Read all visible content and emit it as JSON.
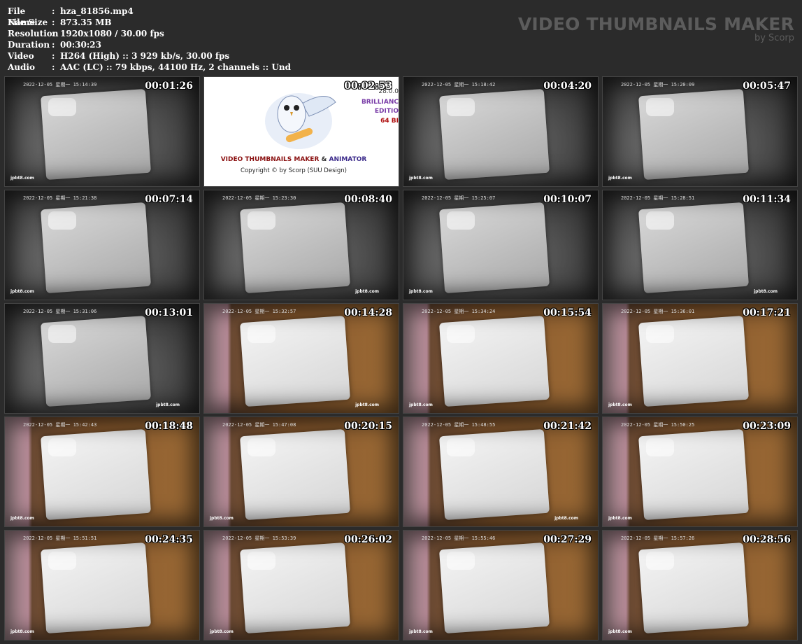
{
  "meta": [
    {
      "key": "File Name",
      "value": "hza_81856.mp4"
    },
    {
      "key": "File Size",
      "value": "873.35 MB"
    },
    {
      "key": "Resolution",
      "value": "1920x1080 / 30.00 fps"
    },
    {
      "key": "Duration",
      "value": "00:30:23"
    },
    {
      "key": "Video",
      "value": "H264 (High) :: 3 929 kb/s, 30.00 fps"
    },
    {
      "key": "Audio",
      "value": "AAC (LC) :: 79 kbps, 44100 Hz, 2 channels :: Und"
    }
  ],
  "separator": ":",
  "brand": {
    "title": "VIDEO THUMBNAILS MAKER",
    "subtitle": "by Scorp"
  },
  "splash": {
    "title_a": "VIDEO THUMBNAILS MAKER",
    "title_amp": " & ",
    "title_b": "ANIMATOR",
    "copyright": "Copyright © by Scorp (SUU Design)",
    "edition_line1": "BRILLIANC",
    "edition_line2": "EDITIO",
    "version": "28.0.0",
    "bits": "64 BI"
  },
  "thumbnails": [
    {
      "time": "00:01:26",
      "stamp": "2022-12-05 星期一 15:14:39",
      "style": "gray",
      "wm": "jpbt8.com",
      "wm_pos": "left"
    },
    {
      "time": "00:02:53",
      "style": "splash"
    },
    {
      "time": "00:04:20",
      "stamp": "2022-12-05 星期一 15:18:42",
      "style": "gray",
      "wm": "jpbt8.com",
      "wm_pos": "left"
    },
    {
      "time": "00:05:47",
      "stamp": "2022-12-05 星期一 15:20:09",
      "style": "gray",
      "wm": "jpbt8.com",
      "wm_pos": "left"
    },
    {
      "time": "00:07:14",
      "stamp": "2022-12-05 星期一 15:21:38",
      "style": "gray",
      "wm": "jpbt8.com",
      "wm_pos": "left"
    },
    {
      "time": "00:08:40",
      "stamp": "2022-12-05 星期一 15:23:30",
      "style": "gray",
      "wm": "jpbt8.com",
      "wm_pos": "right"
    },
    {
      "time": "00:10:07",
      "stamp": "2022-12-05 星期一 15:25:07",
      "style": "gray",
      "wm": "jpbt8.com",
      "wm_pos": "left"
    },
    {
      "time": "00:11:34",
      "stamp": "2022-12-05 星期一 15:28:51",
      "style": "gray",
      "wm": "jpbt8.com",
      "wm_pos": "right"
    },
    {
      "time": "00:13:01",
      "stamp": "2022-12-05 星期一 15:31:06",
      "style": "gray",
      "wm": "jpbt8.com",
      "wm_pos": "right"
    },
    {
      "time": "00:14:28",
      "stamp": "2022-12-05 星期一 15:32:57",
      "style": "color",
      "wm": "jpbt8.com",
      "wm_pos": "right"
    },
    {
      "time": "00:15:54",
      "stamp": "2022-12-05 星期一 15:34:24",
      "style": "color",
      "wm": "jpbt8.com",
      "wm_pos": "left"
    },
    {
      "time": "00:17:21",
      "stamp": "2022-12-05 星期一 15:36:01",
      "style": "color",
      "wm": "jpbt8.com",
      "wm_pos": "left"
    },
    {
      "time": "00:18:48",
      "stamp": "2022-12-05 星期一 15:42:43",
      "style": "color",
      "wm": "jpbt8.com",
      "wm_pos": "left"
    },
    {
      "time": "00:20:15",
      "stamp": "2022-12-05 星期一 15:47:08",
      "style": "color",
      "wm": "jpbt8.com",
      "wm_pos": "left"
    },
    {
      "time": "00:21:42",
      "stamp": "2022-12-05 星期一 15:48:55",
      "style": "color",
      "wm": "jpbt8.com",
      "wm_pos": "right"
    },
    {
      "time": "00:23:09",
      "stamp": "2022-12-05 星期一 15:50:25",
      "style": "color",
      "wm": "jpbt8.com",
      "wm_pos": "left"
    },
    {
      "time": "00:24:35",
      "stamp": "2022-12-05 星期一 15:51:51",
      "style": "color",
      "wm": "jpbt8.com",
      "wm_pos": "left"
    },
    {
      "time": "00:26:02",
      "stamp": "2022-12-05 星期一 15:53:39",
      "style": "color",
      "wm": "jpbt8.com",
      "wm_pos": "left"
    },
    {
      "time": "00:27:29",
      "stamp": "2022-12-05 星期一 15:55:46",
      "style": "color",
      "wm": "jpbt8.com",
      "wm_pos": "left"
    },
    {
      "time": "00:28:56",
      "stamp": "2022-12-05 星期一 15:57:26",
      "style": "color",
      "wm": "jpbt8.com",
      "wm_pos": "left"
    }
  ]
}
